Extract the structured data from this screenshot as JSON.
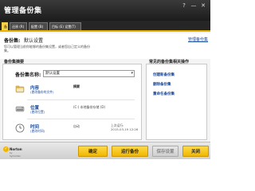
{
  "window": {
    "title": "管理备份集",
    "help_glyph": "?",
    "minimize_glyph": "—",
    "close_glyph": "✕"
  },
  "tabs": [
    {
      "label": "备"
    },
    {
      "label": "还原 (R)"
    },
    {
      "label": "配置 (B)"
    },
    {
      "label": "目标 (E) 设置(T)"
    }
  ],
  "header": {
    "set_label": "备份集:",
    "set_value": "默认设置",
    "manage_link": "管理备份集",
    "description": "您可以管理当前你能够的备份集设置，或者您自己定义的备份集。"
  },
  "summary": {
    "title": "备份集摘要",
    "set_name_label": "备份集名称:",
    "set_name_value": "默认设置",
    "rows": [
      {
        "icon": "folder-icon",
        "title": "内容",
        "sub": "(更改备份的文件)",
        "info": "摘要",
        "info_bold": true,
        "info2": ""
      },
      {
        "icon": "drive-icon",
        "title": "位置",
        "sub": "(更改位置)",
        "info": "(C:) 本地备份存储 (D)",
        "info_bold": false,
        "info2": ""
      },
      {
        "icon": "clock-icon",
        "title": "时间",
        "sub": "(更改时间)",
        "info": "自动",
        "info_bold": false,
        "info2": "上次运行:\n2015-03-19 12:26"
      }
    ]
  },
  "tasks": {
    "title": "常见的备份集相关操作",
    "links": [
      "创建新备份集",
      "删除备份集",
      "重命名备份集"
    ]
  },
  "footer": {
    "brand": "Norton",
    "brand_sub": "by Symantec",
    "buttons": {
      "ok": "确定",
      "run": "运行备份",
      "save": "保存设置",
      "close": "关闭"
    }
  },
  "colors": {
    "accent": "#f0b800",
    "title_bar": "#2a2a2a",
    "link": "#1a4a9c"
  }
}
